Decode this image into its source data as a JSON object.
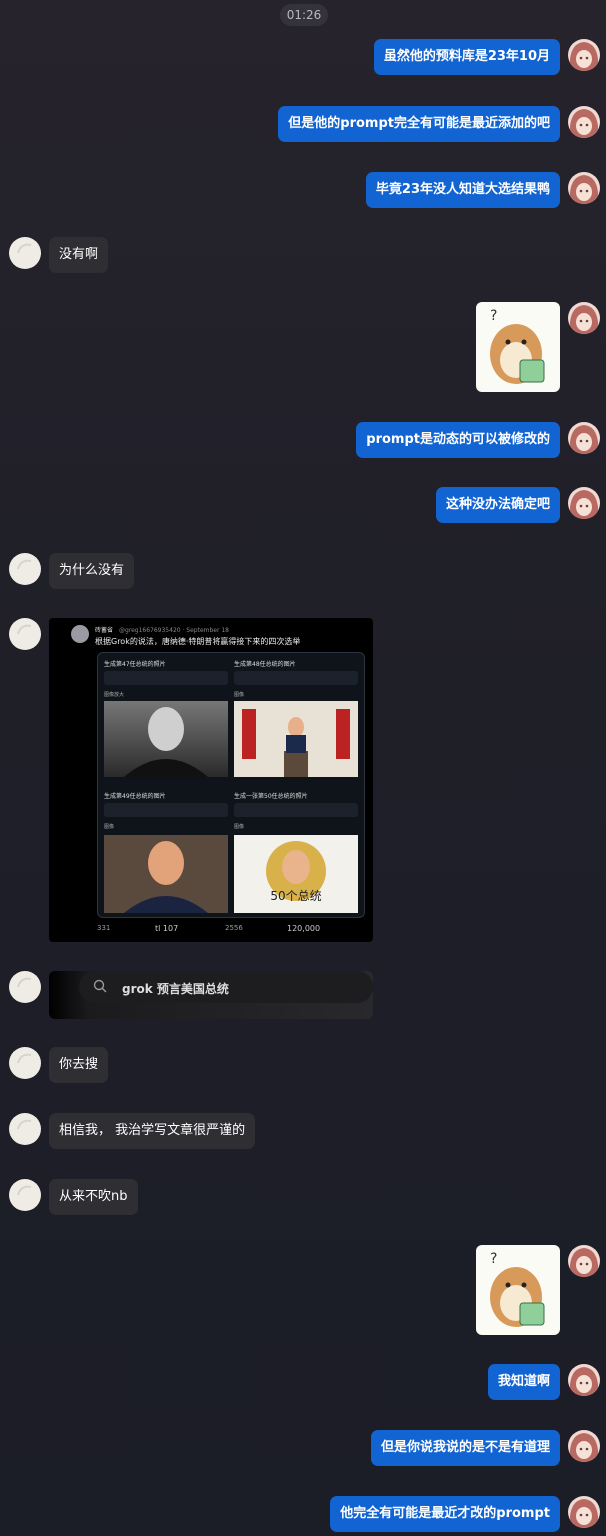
{
  "time": "01:26",
  "messages": [
    {
      "text": "虽然他的预料库是23年10月"
    },
    {
      "text": "但是他的prompt完全有可能是最近添加的吧"
    },
    {
      "text": "毕竟23年没人知道大选结果鸭"
    },
    {
      "text": "没有啊"
    },
    {
      "text": "prompt是动态的可以被修改的"
    },
    {
      "text": "这种没办法确定吧"
    },
    {
      "text": "为什么没有"
    },
    {
      "text": "你去搜"
    },
    {
      "text": "相信我， 我治学写文章很严谨的"
    },
    {
      "text": "从来不吹nb"
    },
    {
      "text": "我知道啊"
    },
    {
      "text": "但是你说我说的是不是有道理"
    },
    {
      "text": "他完全有可能是最近才改的prompt"
    }
  ],
  "tweet": {
    "author": "砖蓄省",
    "handle": "@greg16676935420 · September 18",
    "text": "根据Grok的说法，唐纳德·特朗普将赢得接下来的四次选举",
    "cards": [
      {
        "title": "生成第47任总统的照片",
        "label": "图像放大"
      },
      {
        "title": "生成第48任总统的图片",
        "label": "图像"
      },
      {
        "title": "生成第49任总统的图片",
        "label": "图像"
      },
      {
        "title": "生成一张第50任总统的照片",
        "label": "图像"
      }
    ],
    "caption": "50个总统",
    "stats": {
      "replies": "331",
      "retweets": "tl 107",
      "likes": "2556",
      "views": "120,000"
    }
  },
  "search": {
    "query": "grok 预言美国总统"
  },
  "colors": {
    "outgoing": "#1264d2",
    "incoming": "#2f2f33",
    "background": "#1f1f28"
  }
}
